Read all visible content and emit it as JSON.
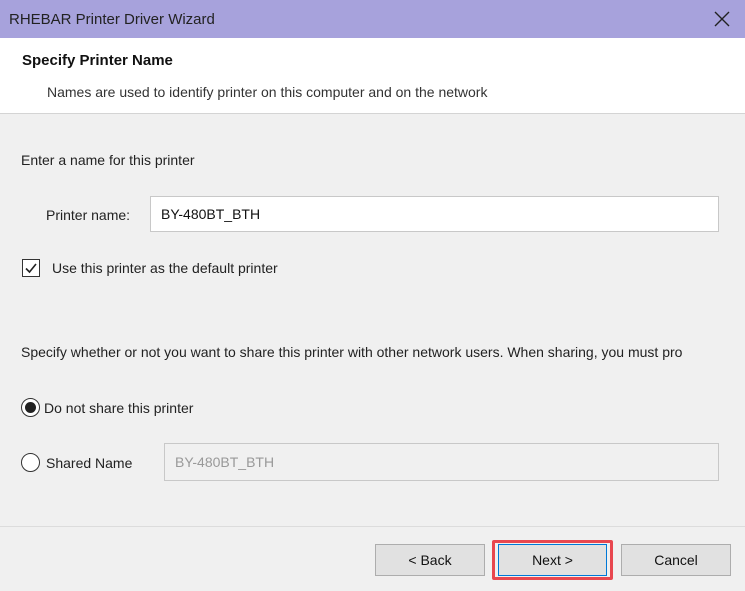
{
  "window": {
    "title": "RHEBAR Printer Driver Wizard"
  },
  "header": {
    "heading": "Specify Printer Name",
    "subtitle": "Names are used to identify printer on this computer and on the network"
  },
  "name_section": {
    "prompt": "Enter a name for this printer",
    "printer_name_label": "Printer name:",
    "printer_name_value": "BY-480BT_BTH",
    "default_checkbox_label": "Use this printer as the default printer",
    "default_checked": true
  },
  "share_section": {
    "description": "Specify whether or not you want to share this printer with other network users. When sharing, you must pro",
    "option_no_share": "Do not share this printer",
    "option_share": "Shared Name",
    "shared_name_value": "BY-480BT_BTH",
    "selected": "no_share"
  },
  "buttons": {
    "back": "< Back",
    "next": "Next >",
    "cancel": "Cancel"
  },
  "colors": {
    "titlebar": "#a7a2dc",
    "highlight": "#e8474f"
  }
}
